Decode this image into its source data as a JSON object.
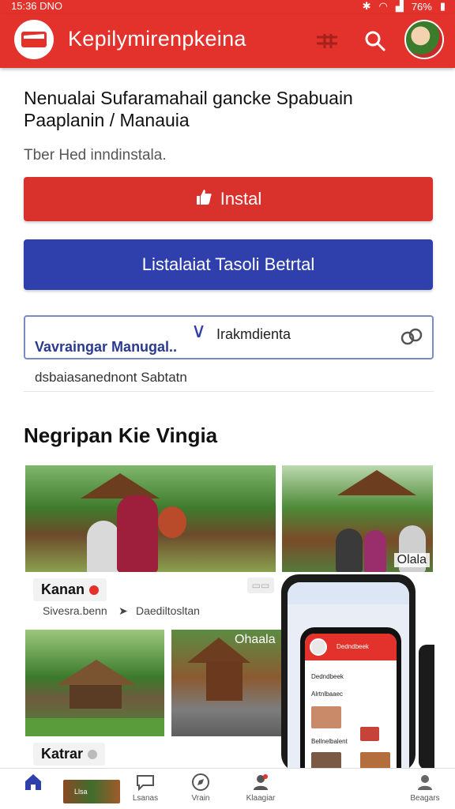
{
  "status_bar": {
    "time": "15:36 DNO",
    "battery": "76%"
  },
  "app_bar": {
    "title": "Kepilymirenpkeina"
  },
  "headline": "Nenualai Sufaramahail gancke Spabuain Paaplanin / Manauia",
  "subtext": "Tber Hed inndinstala.",
  "install_button": {
    "label": "Instal"
  },
  "secondary_button": {
    "label": "Listalaiat Tasoli Betrtal"
  },
  "search": {
    "value": "Irakmdienta",
    "placeholder": "Vavraingar Manugal.."
  },
  "filter": {
    "label": "dsbaiasanednont Sabtatn"
  },
  "section": {
    "title": "Negripan Kie Vingia"
  },
  "cards": [
    {
      "title": "Kanan",
      "subtitle_left": "Sivesra.benn",
      "subtitle_right": "Daediltosltan"
    },
    {
      "overlay": "Olala"
    },
    {
      "title": "Katrar"
    },
    {
      "overlay": "Ohaala"
    }
  ],
  "phone_preview": {
    "title": "Dedndbeek",
    "rows": [
      "Dedndbeek",
      "Alrtnlbaaec",
      "Bellnelbalent"
    ]
  },
  "bottom_nav": [
    {
      "label": "",
      "icon": "home-icon"
    },
    {
      "label": "Llsa",
      "icon": "thumbnail"
    },
    {
      "label": "Lsanas",
      "icon": "chat-icon"
    },
    {
      "label": "Vrain",
      "icon": "compass-icon"
    },
    {
      "label": "Klaagiar",
      "icon": "add-person-icon"
    },
    {
      "label": "Beagars",
      "icon": "person-icon"
    }
  ],
  "colors": {
    "brand_red": "#e2322b",
    "brand_blue": "#2f40ac"
  }
}
